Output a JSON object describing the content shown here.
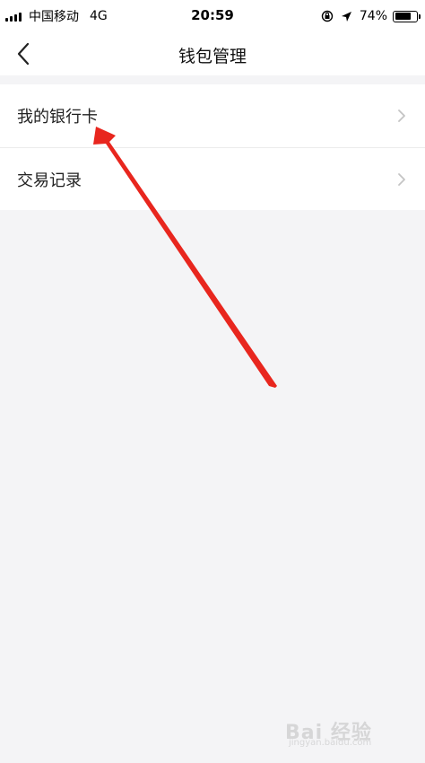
{
  "status_bar": {
    "carrier": "中国移动",
    "network": "4G",
    "time": "20:59",
    "battery": "74%",
    "battery_level": 0.74
  },
  "nav": {
    "title": "钱包管理"
  },
  "menu": {
    "items": [
      {
        "label": "我的银行卡"
      },
      {
        "label": "交易记录"
      }
    ]
  },
  "watermark": {
    "text": "Bai 经验",
    "sub": "jingyan.baidu.com"
  },
  "colors": {
    "background": "#f4f4f6",
    "annotation_arrow": "#e8261e"
  }
}
